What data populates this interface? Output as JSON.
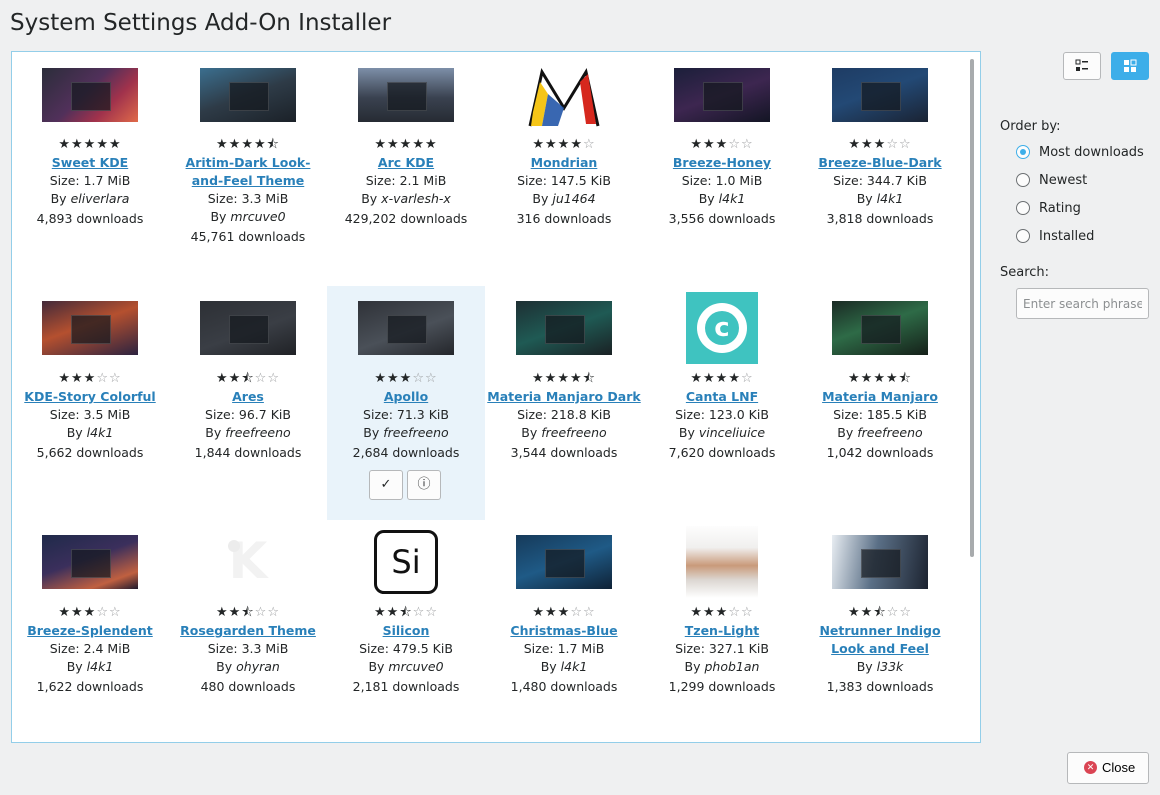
{
  "window": {
    "title": "System Settings Add-On Installer"
  },
  "view_toggle": [
    {
      "name": "list-view-icon",
      "active": false
    },
    {
      "name": "icon-view-icon",
      "active": true
    }
  ],
  "sidebar": {
    "order_label": "Order by:",
    "order_options": [
      {
        "label": "Most downloads",
        "selected": true
      },
      {
        "label": "Newest",
        "selected": false
      },
      {
        "label": "Rating",
        "selected": false
      },
      {
        "label": "Installed",
        "selected": false
      }
    ],
    "search_label": "Search:",
    "search_placeholder": "Enter search phrase",
    "search_value": ""
  },
  "card_actions": {
    "install_icon": "✓",
    "details_icon": "ⓘ"
  },
  "items": [
    {
      "name": "Sweet KDE",
      "rating": 5,
      "size": "Size: 1.7 MiB",
      "by": "By",
      "author": "eliverlara",
      "downloads": "4,893 downloads"
    },
    {
      "name": "Aritim-Dark Look-and-Feel Theme",
      "rating": 4.5,
      "size": "Size: 3.3 MiB",
      "by": "By",
      "author": "mrcuve0",
      "downloads": "45,761 downloads"
    },
    {
      "name": "Arc KDE",
      "rating": 5,
      "size": "Size: 2.1 MiB",
      "by": "By",
      "author": "x-varlesh-x",
      "downloads": "429,202 downloads"
    },
    {
      "name": "Mondrian",
      "rating": 4,
      "size": "Size: 147.5 KiB",
      "by": "By",
      "author": "ju1464",
      "downloads": "316 downloads"
    },
    {
      "name": "Breeze-Honey",
      "rating": 3,
      "size": "Size: 1.0 MiB",
      "by": "By",
      "author": "l4k1",
      "downloads": "3,556 downloads"
    },
    {
      "name": "Breeze-Blue-Dark",
      "rating": 3,
      "size": "Size: 344.7 KiB",
      "by": "By",
      "author": "l4k1",
      "downloads": "3,818 downloads"
    },
    {
      "name": "KDE-Story Colorful",
      "rating": 3,
      "size": "Size: 3.5 MiB",
      "by": "By",
      "author": "l4k1",
      "downloads": "5,662 downloads"
    },
    {
      "name": "Ares",
      "rating": 2.5,
      "size": "Size: 96.7 KiB",
      "by": "By",
      "author": "freefreeno",
      "downloads": "1,844 downloads"
    },
    {
      "name": "Apollo",
      "rating": 3,
      "size": "Size: 71.3 KiB",
      "by": "By",
      "author": "freefreeno",
      "downloads": "2,684 downloads"
    },
    {
      "name": "Materia Manjaro Dark",
      "rating": 4.5,
      "size": "Size: 218.8 KiB",
      "by": "By",
      "author": "freefreeno",
      "downloads": "3,544 downloads"
    },
    {
      "name": "Canta LNF",
      "rating": 4,
      "size": "Size: 123.0 KiB",
      "by": "By",
      "author": "vinceliuice",
      "downloads": "7,620 downloads"
    },
    {
      "name": "Materia Manjaro",
      "rating": 4.5,
      "size": "Size: 185.5 KiB",
      "by": "By",
      "author": "freefreeno",
      "downloads": "1,042 downloads"
    },
    {
      "name": "Breeze-Splendent",
      "rating": 3,
      "size": "Size: 2.4 MiB",
      "by": "By",
      "author": "l4k1",
      "downloads": "1,622 downloads"
    },
    {
      "name": "Rosegarden Theme",
      "rating": 2.5,
      "size": "Size: 3.3 MiB",
      "by": "By",
      "author": "ohyran",
      "downloads": "480 downloads"
    },
    {
      "name": "Silicon",
      "rating": 2.5,
      "size": "Size: 479.5 KiB",
      "by": "By",
      "author": "mrcuve0",
      "downloads": "2,181 downloads"
    },
    {
      "name": "Christmas-Blue",
      "rating": 3,
      "size": "Size: 1.7 MiB",
      "by": "By",
      "author": "l4k1",
      "downloads": "1,480 downloads"
    },
    {
      "name": "Tzen-Light",
      "rating": 3,
      "size": "Size: 327.1 KiB",
      "by": "By",
      "author": "phob1an",
      "downloads": "1,299 downloads"
    },
    {
      "name": "Netrunner Indigo Look and Feel",
      "rating": 2.5,
      "size": "",
      "by": "By",
      "author": "l33k",
      "downloads": "1,383 downloads"
    }
  ],
  "footer": {
    "close_label": "Close"
  }
}
